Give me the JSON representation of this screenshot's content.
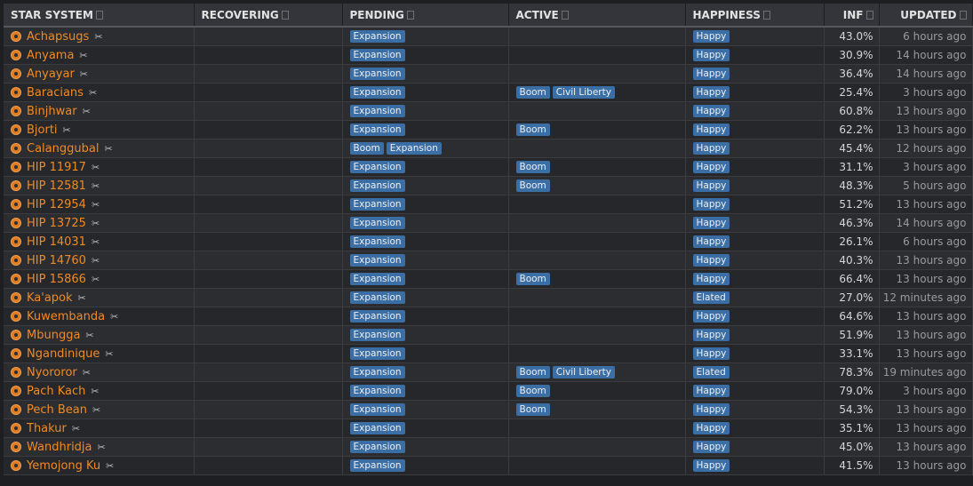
{
  "headers": {
    "star_system": "STAR SYSTEM",
    "recovering": "RECOVERING",
    "pending": "PENDING",
    "active": "ACTIVE",
    "happiness": "HAPPINESS",
    "inf": "INF",
    "updated": "UPDATED"
  },
  "icons": {
    "system": "star-system-icon",
    "scissors": "scissors-icon",
    "sort": "sort-icon"
  },
  "colors": {
    "system_name": "#f08a24",
    "badge": "#3a6ea5",
    "background": "#1d1f23"
  },
  "rows": [
    {
      "system": "Achapsugs",
      "recovering": [],
      "pending": [
        "Expansion"
      ],
      "active": [],
      "happiness": "Happy",
      "inf": "43.0%",
      "updated": "6 hours ago"
    },
    {
      "system": "Anyama",
      "recovering": [],
      "pending": [
        "Expansion"
      ],
      "active": [],
      "happiness": "Happy",
      "inf": "30.9%",
      "updated": "14 hours ago"
    },
    {
      "system": "Anyayar",
      "recovering": [],
      "pending": [
        "Expansion"
      ],
      "active": [],
      "happiness": "Happy",
      "inf": "36.4%",
      "updated": "14 hours ago"
    },
    {
      "system": "Baracians",
      "recovering": [],
      "pending": [
        "Expansion"
      ],
      "active": [
        "Boom",
        "Civil Liberty"
      ],
      "happiness": "Happy",
      "inf": "25.4%",
      "updated": "3 hours ago"
    },
    {
      "system": "Binjhwar",
      "recovering": [],
      "pending": [
        "Expansion"
      ],
      "active": [],
      "happiness": "Happy",
      "inf": "60.8%",
      "updated": "13 hours ago"
    },
    {
      "system": "Bjorti",
      "recovering": [],
      "pending": [
        "Expansion"
      ],
      "active": [
        "Boom"
      ],
      "happiness": "Happy",
      "inf": "62.2%",
      "updated": "13 hours ago"
    },
    {
      "system": "Calanggubal",
      "recovering": [],
      "pending": [
        "Boom",
        "Expansion"
      ],
      "active": [],
      "happiness": "Happy",
      "inf": "45.4%",
      "updated": "12 hours ago"
    },
    {
      "system": "HIP 11917",
      "recovering": [],
      "pending": [
        "Expansion"
      ],
      "active": [
        "Boom"
      ],
      "happiness": "Happy",
      "inf": "31.1%",
      "updated": "3 hours ago"
    },
    {
      "system": "HIP 12581",
      "recovering": [],
      "pending": [
        "Expansion"
      ],
      "active": [
        "Boom"
      ],
      "happiness": "Happy",
      "inf": "48.3%",
      "updated": "5 hours ago"
    },
    {
      "system": "HIP 12954",
      "recovering": [],
      "pending": [
        "Expansion"
      ],
      "active": [],
      "happiness": "Happy",
      "inf": "51.2%",
      "updated": "13 hours ago"
    },
    {
      "system": "HIP 13725",
      "recovering": [],
      "pending": [
        "Expansion"
      ],
      "active": [],
      "happiness": "Happy",
      "inf": "46.3%",
      "updated": "14 hours ago"
    },
    {
      "system": "HIP 14031",
      "recovering": [],
      "pending": [
        "Expansion"
      ],
      "active": [],
      "happiness": "Happy",
      "inf": "26.1%",
      "updated": "6 hours ago"
    },
    {
      "system": "HIP 14760",
      "recovering": [],
      "pending": [
        "Expansion"
      ],
      "active": [],
      "happiness": "Happy",
      "inf": "40.3%",
      "updated": "13 hours ago"
    },
    {
      "system": "HIP 15866",
      "recovering": [],
      "pending": [
        "Expansion"
      ],
      "active": [
        "Boom"
      ],
      "happiness": "Happy",
      "inf": "66.4%",
      "updated": "13 hours ago"
    },
    {
      "system": "Ka'apok",
      "recovering": [],
      "pending": [
        "Expansion"
      ],
      "active": [],
      "happiness": "Elated",
      "inf": "27.0%",
      "updated": "12 minutes ago"
    },
    {
      "system": "Kuwembanda",
      "recovering": [],
      "pending": [
        "Expansion"
      ],
      "active": [],
      "happiness": "Happy",
      "inf": "64.6%",
      "updated": "13 hours ago"
    },
    {
      "system": "Mbungga",
      "recovering": [],
      "pending": [
        "Expansion"
      ],
      "active": [],
      "happiness": "Happy",
      "inf": "51.9%",
      "updated": "13 hours ago"
    },
    {
      "system": "Ngandinique",
      "recovering": [],
      "pending": [
        "Expansion"
      ],
      "active": [],
      "happiness": "Happy",
      "inf": "33.1%",
      "updated": "13 hours ago"
    },
    {
      "system": "Nyororor",
      "recovering": [],
      "pending": [
        "Expansion"
      ],
      "active": [
        "Boom",
        "Civil Liberty"
      ],
      "happiness": "Elated",
      "inf": "78.3%",
      "updated": "19 minutes ago"
    },
    {
      "system": "Pach Kach",
      "recovering": [],
      "pending": [
        "Expansion"
      ],
      "active": [
        "Boom"
      ],
      "happiness": "Happy",
      "inf": "79.0%",
      "updated": "3 hours ago"
    },
    {
      "system": "Pech Bean",
      "recovering": [],
      "pending": [
        "Expansion"
      ],
      "active": [
        "Boom"
      ],
      "happiness": "Happy",
      "inf": "54.3%",
      "updated": "13 hours ago"
    },
    {
      "system": "Thakur",
      "recovering": [],
      "pending": [
        "Expansion"
      ],
      "active": [],
      "happiness": "Happy",
      "inf": "35.1%",
      "updated": "13 hours ago"
    },
    {
      "system": "Wandhridja",
      "recovering": [],
      "pending": [
        "Expansion"
      ],
      "active": [],
      "happiness": "Happy",
      "inf": "45.0%",
      "updated": "13 hours ago"
    },
    {
      "system": "Yemojong Ku",
      "recovering": [],
      "pending": [
        "Expansion"
      ],
      "active": [],
      "happiness": "Happy",
      "inf": "41.5%",
      "updated": "13 hours ago"
    }
  ]
}
